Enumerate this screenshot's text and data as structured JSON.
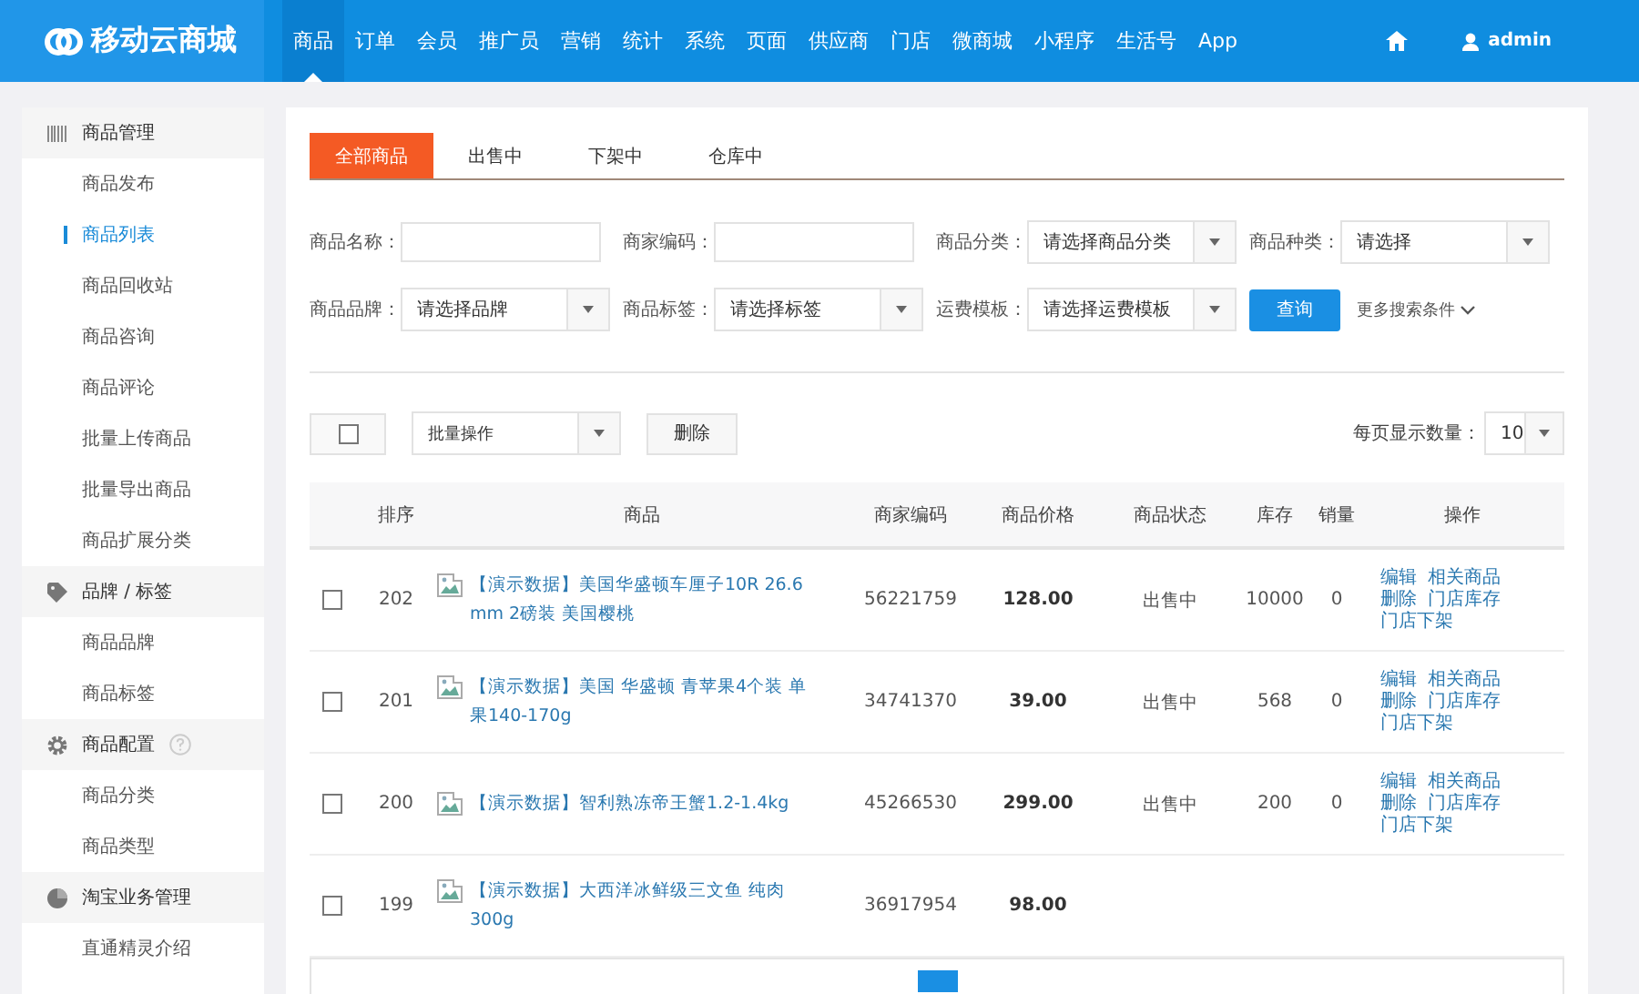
{
  "topbar": {
    "logo": "移动云商城",
    "user": "admin",
    "nav": [
      {
        "label": "商品",
        "selected": true
      },
      {
        "label": "订单",
        "selected": false
      },
      {
        "label": "会员",
        "selected": false
      },
      {
        "label": "推广员",
        "selected": false
      },
      {
        "label": "营销",
        "selected": false
      },
      {
        "label": "统计",
        "selected": false
      },
      {
        "label": "系统",
        "selected": false
      },
      {
        "label": "页面",
        "selected": false
      },
      {
        "label": "供应商",
        "selected": false
      },
      {
        "label": "门店",
        "selected": false
      },
      {
        "label": "微商城",
        "selected": false
      },
      {
        "label": "小程序",
        "selected": false
      },
      {
        "label": "生活号",
        "selected": false
      },
      {
        "label": "App",
        "selected": false
      }
    ]
  },
  "sidebar": {
    "groups": [
      {
        "label": "商品管理",
        "help": false,
        "items": [
          {
            "label": "商品发布",
            "selected": false
          },
          {
            "label": "商品列表",
            "selected": true
          },
          {
            "label": "商品回收站",
            "selected": false
          },
          {
            "label": "商品咨询",
            "selected": false
          },
          {
            "label": "商品评论",
            "selected": false
          },
          {
            "label": "批量上传商品",
            "selected": false
          },
          {
            "label": "批量导出商品",
            "selected": false
          },
          {
            "label": "商品扩展分类",
            "selected": false
          }
        ]
      },
      {
        "label": "品牌 / 标签",
        "help": false,
        "items": [
          {
            "label": "商品品牌",
            "selected": false
          },
          {
            "label": "商品标签",
            "selected": false
          }
        ]
      },
      {
        "label": "商品配置",
        "help": true,
        "items": [
          {
            "label": "商品分类",
            "selected": false
          },
          {
            "label": "商品类型",
            "selected": false
          }
        ]
      },
      {
        "label": "淘宝业务管理",
        "help": false,
        "items": [
          {
            "label": "直通精灵介绍",
            "selected": false
          }
        ]
      }
    ]
  },
  "tabs": [
    {
      "label": "全部商品",
      "selected": true
    },
    {
      "label": "出售中",
      "selected": false
    },
    {
      "label": "下架中",
      "selected": false
    },
    {
      "label": "仓库中",
      "selected": false
    }
  ],
  "filters": [
    {
      "kind": "input",
      "label": "商品名称："
    },
    {
      "kind": "input",
      "label": "商家编码："
    },
    {
      "kind": "select",
      "label": "商品分类：",
      "value": "请选择商品分类"
    },
    {
      "kind": "select",
      "label": "商品种类：",
      "value": "请选择"
    },
    {
      "kind": "select",
      "label": "商品品牌：",
      "value": "请选择品牌"
    },
    {
      "kind": "select",
      "label": "商品标签：",
      "value": "请选择标签"
    },
    {
      "kind": "select",
      "label": "运费模板：",
      "value": "请选择运费模板"
    }
  ],
  "search_button": "查询",
  "more_link": "更多搜索条件",
  "toolbar": {
    "select_all_checked": false,
    "batch_select": "批量操作",
    "delete_button": "删除",
    "page_size_label": "每页显示数量：",
    "page_size": "10"
  },
  "table": {
    "columns": [
      "排序",
      "商品",
      "商家编码",
      "商品价格",
      "商品状态",
      "库存",
      "销量",
      "操作"
    ],
    "rows": [
      {
        "checked": false,
        "sort": "202",
        "name": "【演示数据】美国华盛顿车厘子10R 26.6 mm 2磅装 美国樱桃",
        "code": "56221759",
        "price": "128.00",
        "status": "出售中",
        "stock": "10000",
        "sales": "0",
        "actions": [
          "编辑",
          "相关商品",
          "删除",
          "门店库存",
          "门店下架"
        ]
      },
      {
        "checked": false,
        "sort": "201",
        "name": "【演示数据】美国 华盛顿 青苹果4个装 单果140-170g",
        "code": "34741370",
        "price": "39.00",
        "status": "出售中",
        "stock": "568",
        "sales": "0",
        "actions": [
          "编辑",
          "相关商品",
          "删除",
          "门店库存",
          "门店下架"
        ]
      },
      {
        "checked": false,
        "sort": "200",
        "name": "【演示数据】智利熟冻帝王蟹1.2-1.4kg",
        "code": "45266530",
        "price": "299.00",
        "status": "出售中",
        "stock": "200",
        "sales": "0",
        "actions": [
          "编辑",
          "相关商品",
          "删除",
          "门店库存",
          "门店下架"
        ]
      },
      {
        "checked": false,
        "sort": "199",
        "name": "【演示数据】大西洋冰鲜级三文鱼 纯肉300g",
        "code": "36917954",
        "price": "98.00"
      }
    ]
  }
}
